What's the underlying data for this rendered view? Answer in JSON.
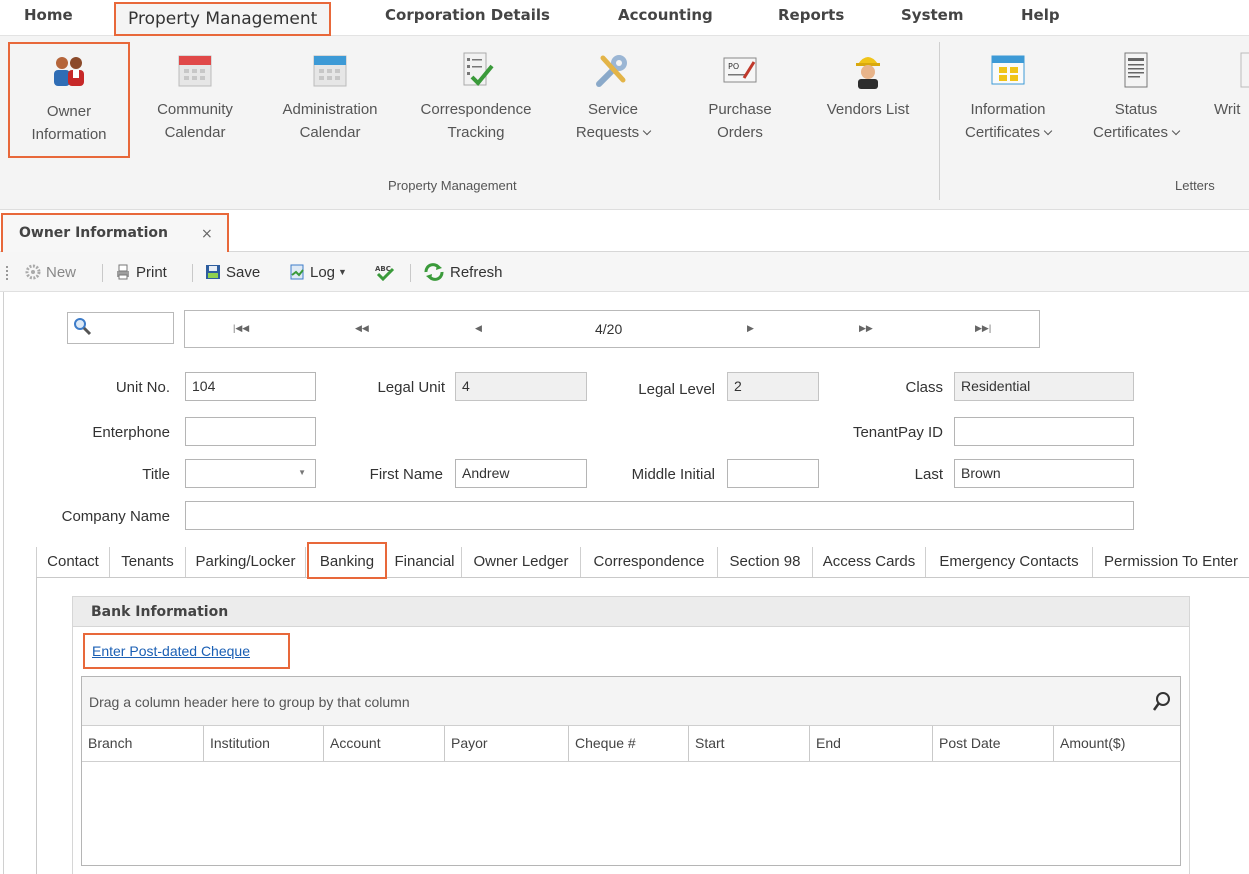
{
  "menu": {
    "tabs": [
      {
        "label": "Home"
      },
      {
        "label": "Property Management"
      },
      {
        "label": "Corporation Details"
      },
      {
        "label": "Accounting"
      },
      {
        "label": "Reports"
      },
      {
        "label": "System"
      },
      {
        "label": "Help"
      }
    ],
    "active_tab": "Property Management"
  },
  "ribbon": {
    "groups": [
      {
        "label": "Property Management"
      },
      {
        "label": "Letters"
      }
    ],
    "buttons": [
      {
        "line1": "Owner",
        "line2": "Information",
        "icon": "owner-people-icon",
        "selected": true
      },
      {
        "line1": "Community",
        "line2": "Calendar",
        "icon": "calendar-icon"
      },
      {
        "line1": "Administration",
        "line2": "Calendar",
        "icon": "calendar-icon"
      },
      {
        "line1": "Correspondence",
        "line2": "Tracking",
        "icon": "checklist-icon"
      },
      {
        "line1": "Service",
        "line2": "Requests",
        "icon": "tools-icon",
        "dropdown": true
      },
      {
        "line1": "Purchase",
        "line2": "Orders",
        "icon": "purchase-order-icon"
      },
      {
        "line1": "Vendors List",
        "line2": "",
        "icon": "worker-icon"
      },
      {
        "line1": "Information",
        "line2": "Certificates",
        "icon": "certificate-icon",
        "dropdown": true
      },
      {
        "line1": "Status",
        "line2": "Certificates",
        "icon": "document-icon",
        "dropdown": true
      },
      {
        "line1": "Writ",
        "line2": "",
        "icon": "document-icon"
      }
    ]
  },
  "document_tab": {
    "title": "Owner Information",
    "close": "×"
  },
  "toolbar": {
    "new": "New",
    "print": "Print",
    "save": "Save",
    "log": "Log",
    "refresh": "Refresh"
  },
  "navigator": {
    "position": "4/20"
  },
  "form": {
    "unit_no": {
      "label": "Unit No.",
      "value": "104"
    },
    "legal_unit": {
      "label": "Legal Unit",
      "value": "4"
    },
    "legal_level": {
      "label": "Legal Level",
      "value": "2"
    },
    "class": {
      "label": "Class",
      "value": "Residential"
    },
    "enterphone": {
      "label": "Enterphone",
      "value": ""
    },
    "tenantpay_id": {
      "label": "TenantPay ID",
      "value": ""
    },
    "title": {
      "label": "Title",
      "value": ""
    },
    "first_name": {
      "label": "First Name",
      "value": "Andrew"
    },
    "middle_initial": {
      "label": "Middle Initial",
      "value": ""
    },
    "last": {
      "label": "Last",
      "value": "Brown"
    },
    "company_name": {
      "label": "Company Name",
      "value": ""
    }
  },
  "inner_tabs": [
    "Contact",
    "Tenants",
    "Parking/Locker",
    "Banking",
    "Financial",
    "Owner Ledger",
    "Correspondence",
    "Section 98",
    "Access Cards",
    "Emergency Contacts",
    "Permission To Enter"
  ],
  "active_inner_tab": "Banking",
  "banking": {
    "section_title": "Bank Information",
    "link": "Enter Post-dated Cheque",
    "group_hint": "Drag a column header here to group by that column",
    "columns": [
      "Branch",
      "Institution",
      "Account",
      "Payor",
      "Cheque #",
      "Start",
      "End",
      "Post Date",
      "Amount($)"
    ],
    "rows": []
  },
  "colors": {
    "highlight": "#e8683a",
    "ribbon_bg": "#f4f4f4",
    "link": "#1a5fb4"
  }
}
